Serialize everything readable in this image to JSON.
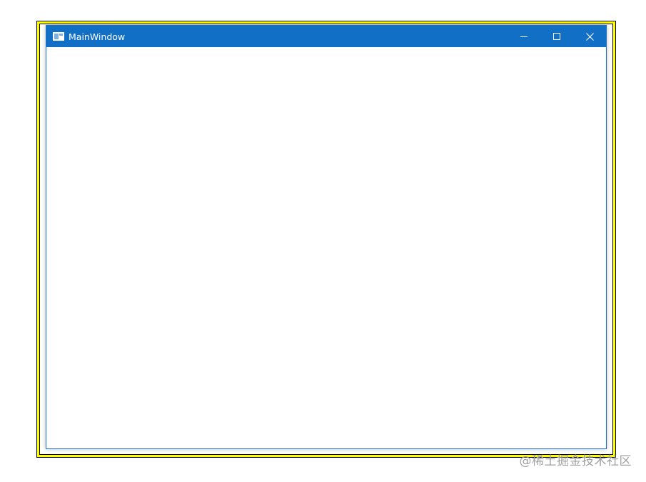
{
  "window": {
    "title": "MainWindow",
    "accent_color": "#1170c5",
    "icon": "app-window-icon",
    "controls": {
      "minimize_icon": "minimize-icon",
      "maximize_icon": "maximize-icon",
      "close_icon": "close-icon"
    }
  },
  "highlight_frame_color": "#ffff00",
  "watermark": {
    "text": "@稀土掘金技术社区"
  }
}
